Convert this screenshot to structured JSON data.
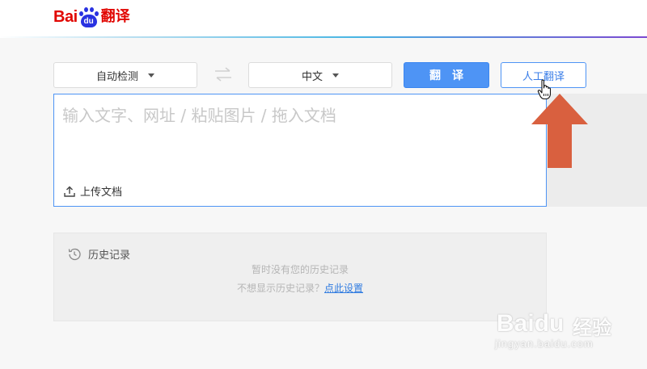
{
  "header": {
    "logo_bai": "Bai",
    "logo_du": "du",
    "logo_suffix": "翻译"
  },
  "toolbar": {
    "source_lang": "自动检测",
    "target_lang": "中文",
    "translate_label": "翻译",
    "human_translate_label": "人工翻译"
  },
  "input": {
    "placeholder": "输入文字、网址 / 粘贴图片 / 拖入文档",
    "value": "",
    "upload_label": "上传文档"
  },
  "history": {
    "title": "历史记录",
    "empty_text": "暂时没有您的历史记录",
    "hint_text": "不想显示历史记录？",
    "hint_link": "点此设置"
  },
  "watermark": {
    "brand_bai": "Bai",
    "brand_du": "du",
    "brand_suffix": "经验",
    "url": "jingyan.baidu.com"
  },
  "colors": {
    "brand_red": "#e10601",
    "brand_blue": "#2932e1",
    "accent": "#4e94f5",
    "annotation_arrow": "#d9603f"
  },
  "icons": {
    "swap": "swap-arrows-icon",
    "upload": "upload-icon",
    "history": "history-clock-icon",
    "caret": "caret-down-icon",
    "pointer": "hand-pointer-icon",
    "annotation": "up-arrow-annotation"
  }
}
